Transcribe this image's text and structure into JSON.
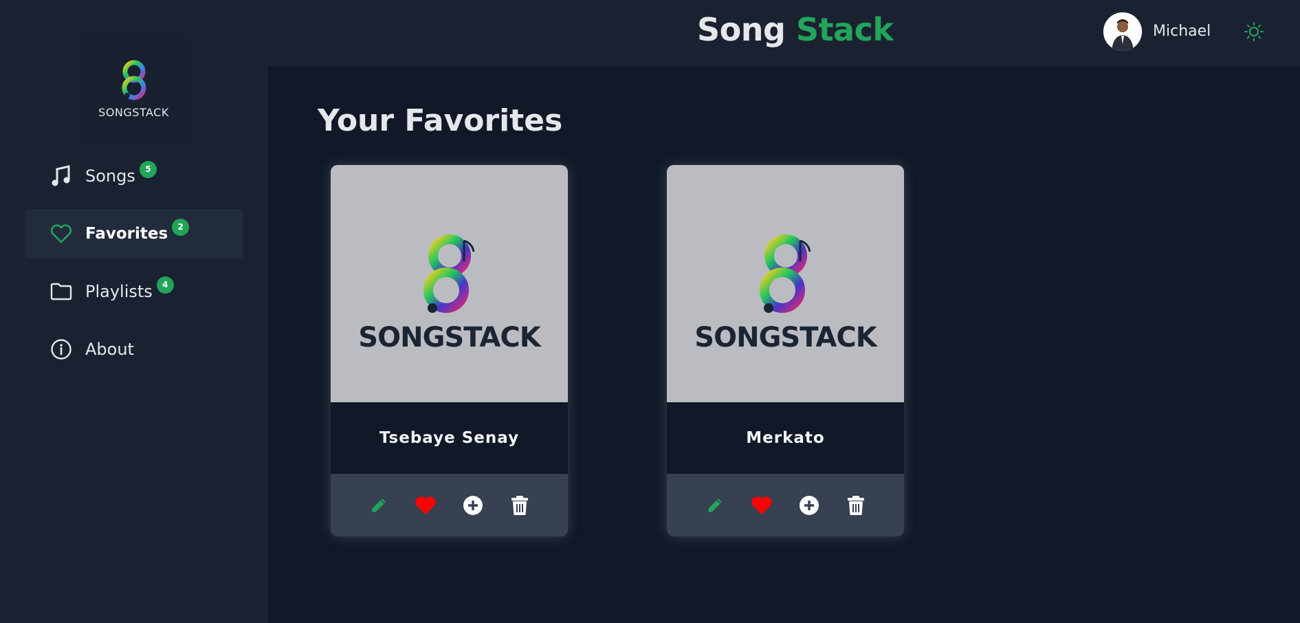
{
  "app": {
    "brand_part1": "Song",
    "brand_part2": "Stack",
    "logo_text": "SONGSTACK"
  },
  "user": {
    "name": "Michael"
  },
  "sidebar": {
    "items": [
      {
        "label": "Songs",
        "badge": "5",
        "icon": "music-note-icon"
      },
      {
        "label": "Favorites",
        "badge": "2",
        "icon": "heart-icon",
        "active": true
      },
      {
        "label": "Playlists",
        "badge": "4",
        "icon": "folder-icon"
      },
      {
        "label": "About",
        "badge": "",
        "icon": "info-icon"
      }
    ]
  },
  "main": {
    "title": "Your Favorites",
    "cards": [
      {
        "title": "Tsebaye Senay",
        "image_text": "SONGSTACK"
      },
      {
        "title": "Merkato",
        "image_text": "SONGSTACK"
      }
    ]
  },
  "colors": {
    "accent": "#22a55a",
    "heart": "#ff0000",
    "background": "#111827",
    "panel": "#1a2232"
  }
}
